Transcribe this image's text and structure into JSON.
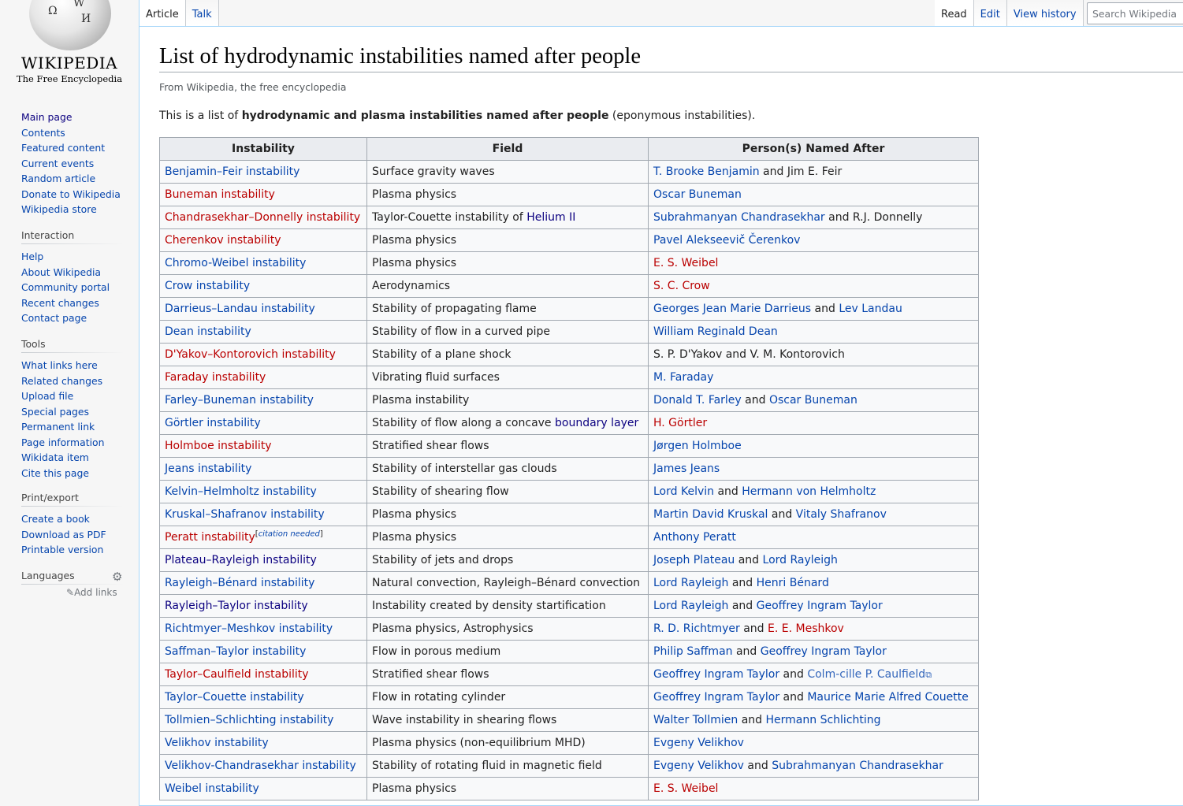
{
  "logo": {
    "wordmark": "WIKIPEDIA",
    "tagline": "The Free Encyclopedia",
    "glyph1": "Ω",
    "glyph2": "W",
    "glyph3": "И"
  },
  "tabs": {
    "left": [
      "Article",
      "Talk"
    ],
    "right": [
      "Read",
      "Edit",
      "View history"
    ]
  },
  "search": {
    "placeholder": "Search Wikipedia"
  },
  "nav": {
    "items": [
      "Main page",
      "Contents",
      "Featured content",
      "Current events",
      "Random article",
      "Donate to Wikipedia",
      "Wikipedia store"
    ]
  },
  "interaction": {
    "heading": "Interaction",
    "items": [
      "Help",
      "About Wikipedia",
      "Community portal",
      "Recent changes",
      "Contact page"
    ]
  },
  "tools": {
    "heading": "Tools",
    "items": [
      "What links here",
      "Related changes",
      "Upload file",
      "Special pages",
      "Permanent link",
      "Page information",
      "Wikidata item",
      "Cite this page"
    ]
  },
  "print": {
    "heading": "Print/export",
    "items": [
      "Create a book",
      "Download as PDF",
      "Printable version"
    ]
  },
  "languages": {
    "heading": "Languages",
    "add_links": "Add links",
    "gear": "gear-icon",
    "pencil": "pencil-icon"
  },
  "page": {
    "title": "List of hydrodynamic instabilities named after people",
    "from": "From Wikipedia, the free encyclopedia",
    "intro_pre": "This is a list of ",
    "intro_bold": "hydrodynamic and plasma instabilities named after people",
    "intro_post": " (eponymous instabilities)."
  },
  "table": {
    "headers": [
      "Instability",
      "Field",
      "Person(s) Named After"
    ],
    "rows": [
      {
        "instability": {
          "text": "Benjamin–Feir instability",
          "link": "blue"
        },
        "field": [
          {
            "text": "Surface gravity waves"
          }
        ],
        "persons": [
          {
            "text": "T. Brooke Benjamin",
            "link": "blue"
          },
          {
            "text": " and Jim E. Feir"
          }
        ]
      },
      {
        "instability": {
          "text": "Buneman instability",
          "link": "red"
        },
        "field": [
          {
            "text": "Plasma physics"
          }
        ],
        "persons": [
          {
            "text": "Oscar Buneman",
            "link": "blue"
          }
        ]
      },
      {
        "instability": {
          "text": "Chandrasekhar–Donnelly instability",
          "link": "red"
        },
        "field": [
          {
            "text": "Taylor-Couette instability of "
          },
          {
            "text": "Helium II",
            "link": "visited"
          }
        ],
        "persons": [
          {
            "text": "Subrahmanyan Chandrasekhar",
            "link": "blue"
          },
          {
            "text": " and R.J. Donnelly"
          }
        ]
      },
      {
        "instability": {
          "text": "Cherenkov instability",
          "link": "red"
        },
        "field": [
          {
            "text": "Plasma physics"
          }
        ],
        "persons": [
          {
            "text": "Pavel Alekseevič Čerenkov",
            "link": "blue"
          }
        ]
      },
      {
        "instability": {
          "text": "Chromo-Weibel instability",
          "link": "blue"
        },
        "field": [
          {
            "text": "Plasma physics"
          }
        ],
        "persons": [
          {
            "text": "E. S. Weibel",
            "link": "red"
          }
        ]
      },
      {
        "instability": {
          "text": "Crow instability",
          "link": "blue"
        },
        "field": [
          {
            "text": "Aerodynamics"
          }
        ],
        "persons": [
          {
            "text": "S. C. Crow",
            "link": "red"
          }
        ]
      },
      {
        "instability": {
          "text": "Darrieus–Landau instability",
          "link": "blue"
        },
        "field": [
          {
            "text": "Stability of propagating flame"
          }
        ],
        "persons": [
          {
            "text": "Georges Jean Marie Darrieus",
            "link": "blue"
          },
          {
            "text": " and "
          },
          {
            "text": "Lev Landau",
            "link": "blue"
          }
        ]
      },
      {
        "instability": {
          "text": "Dean instability",
          "link": "blue"
        },
        "field": [
          {
            "text": "Stability of flow in a curved pipe"
          }
        ],
        "persons": [
          {
            "text": "William Reginald Dean",
            "link": "blue"
          }
        ]
      },
      {
        "instability": {
          "text": "D'Yakov–Kontorovich instability",
          "link": "red"
        },
        "field": [
          {
            "text": "Stability of a plane shock"
          }
        ],
        "persons": [
          {
            "text": "S. P. D'Yakov and V. M. Kontorovich"
          }
        ]
      },
      {
        "instability": {
          "text": "Faraday instability",
          "link": "red"
        },
        "field": [
          {
            "text": "Vibrating fluid surfaces"
          }
        ],
        "persons": [
          {
            "text": "M. Faraday",
            "link": "blue"
          }
        ]
      },
      {
        "instability": {
          "text": "Farley–Buneman instability",
          "link": "blue"
        },
        "field": [
          {
            "text": "Plasma instability"
          }
        ],
        "persons": [
          {
            "text": "Donald T. Farley",
            "link": "blue"
          },
          {
            "text": " and "
          },
          {
            "text": "Oscar Buneman",
            "link": "blue"
          }
        ]
      },
      {
        "instability": {
          "text": "Görtler instability",
          "link": "blue"
        },
        "field": [
          {
            "text": "Stability of flow along a concave "
          },
          {
            "text": "boundary layer",
            "link": "visited"
          }
        ],
        "persons": [
          {
            "text": "H. Görtler",
            "link": "red"
          }
        ]
      },
      {
        "instability": {
          "text": "Holmboe instability",
          "link": "red"
        },
        "field": [
          {
            "text": "Stratified shear flows"
          }
        ],
        "persons": [
          {
            "text": "Jørgen Holmboe",
            "link": "blue"
          }
        ]
      },
      {
        "instability": {
          "text": "Jeans instability",
          "link": "blue"
        },
        "field": [
          {
            "text": "Stability of interstellar gas clouds"
          }
        ],
        "persons": [
          {
            "text": "James Jeans",
            "link": "blue"
          }
        ]
      },
      {
        "instability": {
          "text": "Kelvin–Helmholtz instability",
          "link": "blue"
        },
        "field": [
          {
            "text": "Stability of shearing flow"
          }
        ],
        "persons": [
          {
            "text": "Lord Kelvin",
            "link": "blue"
          },
          {
            "text": " and "
          },
          {
            "text": "Hermann von Helmholtz",
            "link": "blue"
          }
        ]
      },
      {
        "instability": {
          "text": "Kruskal–Shafranov instability",
          "link": "blue"
        },
        "field": [
          {
            "text": "Plasma physics"
          }
        ],
        "persons": [
          {
            "text": "Martin David Kruskal",
            "link": "blue"
          },
          {
            "text": " and "
          },
          {
            "text": "Vitaly Shafranov",
            "link": "blue"
          }
        ]
      },
      {
        "instability": {
          "text": "Peratt instability",
          "link": "red",
          "note": "citation needed"
        },
        "field": [
          {
            "text": "Plasma physics"
          }
        ],
        "persons": [
          {
            "text": "Anthony Peratt",
            "link": "blue"
          }
        ]
      },
      {
        "instability": {
          "text": "Plateau–Rayleigh instability",
          "link": "visited"
        },
        "field": [
          {
            "text": "Stability of jets and drops"
          }
        ],
        "persons": [
          {
            "text": "Joseph Plateau",
            "link": "blue"
          },
          {
            "text": " and "
          },
          {
            "text": "Lord Rayleigh",
            "link": "blue"
          }
        ]
      },
      {
        "instability": {
          "text": "Rayleigh–Bénard instability",
          "link": "blue"
        },
        "field": [
          {
            "text": "Natural convection, Rayleigh–Bénard convection"
          }
        ],
        "persons": [
          {
            "text": "Lord Rayleigh",
            "link": "blue"
          },
          {
            "text": " and "
          },
          {
            "text": "Henri Bénard",
            "link": "blue"
          }
        ]
      },
      {
        "instability": {
          "text": "Rayleigh–Taylor instability",
          "link": "visited"
        },
        "field": [
          {
            "text": "Instability created by density startification"
          }
        ],
        "persons": [
          {
            "text": "Lord Rayleigh",
            "link": "blue"
          },
          {
            "text": " and "
          },
          {
            "text": "Geoffrey Ingram Taylor",
            "link": "blue"
          }
        ]
      },
      {
        "instability": {
          "text": "Richtmyer–Meshkov instability",
          "link": "blue"
        },
        "field": [
          {
            "text": "Plasma physics, Astrophysics"
          }
        ],
        "persons": [
          {
            "text": "R. D. Richtmyer",
            "link": "blue"
          },
          {
            "text": " and "
          },
          {
            "text": "E. E. Meshkov",
            "link": "red"
          }
        ]
      },
      {
        "instability": {
          "text": "Saffman–Taylor instability",
          "link": "blue"
        },
        "field": [
          {
            "text": "Flow in porous medium"
          }
        ],
        "persons": [
          {
            "text": "Philip Saffman",
            "link": "blue"
          },
          {
            "text": " and "
          },
          {
            "text": "Geoffrey Ingram Taylor",
            "link": "blue"
          }
        ]
      },
      {
        "instability": {
          "text": "Taylor–Caulfield instability",
          "link": "red"
        },
        "field": [
          {
            "text": "Stratified shear flows"
          }
        ],
        "persons": [
          {
            "text": "Geoffrey Ingram Taylor",
            "link": "blue"
          },
          {
            "text": " and "
          },
          {
            "text": "Colm-cille P. Caulfield",
            "link": "ext"
          }
        ]
      },
      {
        "instability": {
          "text": "Taylor–Couette instability",
          "link": "blue"
        },
        "field": [
          {
            "text": "Flow in rotating cylinder"
          }
        ],
        "persons": [
          {
            "text": "Geoffrey Ingram Taylor",
            "link": "blue"
          },
          {
            "text": " and "
          },
          {
            "text": "Maurice Marie Alfred Couette",
            "link": "blue"
          }
        ]
      },
      {
        "instability": {
          "text": "Tollmien–Schlichting instability",
          "link": "blue"
        },
        "field": [
          {
            "text": "Wave instability in shearing flows"
          }
        ],
        "persons": [
          {
            "text": "Walter Tollmien",
            "link": "blue"
          },
          {
            "text": " and "
          },
          {
            "text": "Hermann Schlichting",
            "link": "blue"
          }
        ]
      },
      {
        "instability": {
          "text": "Velikhov instability",
          "link": "blue"
        },
        "field": [
          {
            "text": "Plasma physics (non-equilibrium MHD)"
          }
        ],
        "persons": [
          {
            "text": "Evgeny Velikhov",
            "link": "blue"
          }
        ]
      },
      {
        "instability": {
          "text": "Velikhov-Chandrasekhar instability",
          "link": "blue"
        },
        "field": [
          {
            "text": "Stability of rotating fluid in magnetic field"
          }
        ],
        "persons": [
          {
            "text": "Evgeny Velikhov",
            "link": "blue"
          },
          {
            "text": " and "
          },
          {
            "text": "Subrahmanyan Chandrasekhar",
            "link": "blue"
          }
        ]
      },
      {
        "instability": {
          "text": "Weibel instability",
          "link": "blue"
        },
        "field": [
          {
            "text": "Plasma physics"
          }
        ],
        "persons": [
          {
            "text": "E. S. Weibel",
            "link": "red"
          }
        ]
      }
    ]
  },
  "colors": {
    "link": "#0645ad",
    "redlink": "#ba0000",
    "visited": "#0b0080",
    "external": "#3366bb"
  }
}
